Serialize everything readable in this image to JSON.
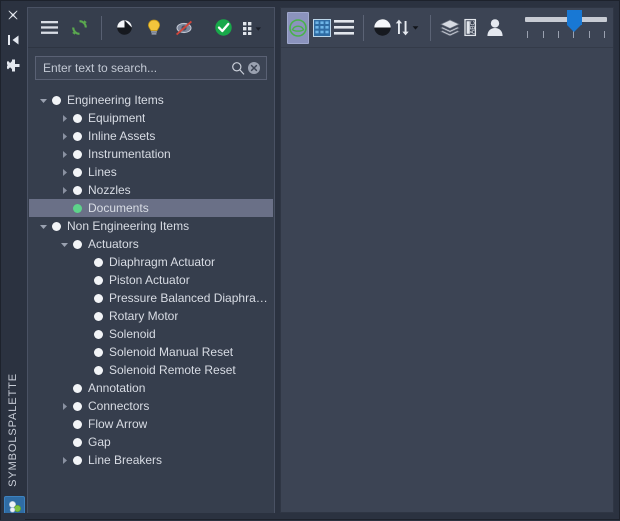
{
  "window": {
    "rail_title": "SYMBOLSPALETTE"
  },
  "rail": {
    "icons": [
      {
        "name": "close-icon",
        "label": "Close"
      },
      {
        "name": "auto-hide-icon",
        "label": "Auto Hide"
      },
      {
        "name": "settings-icon",
        "label": "Settings"
      }
    ],
    "bottom_tab": {
      "name": "symbol-palette-tab-icon",
      "label": "Symbol Palette"
    }
  },
  "panel": {
    "toolbar": [
      {
        "name": "menu-icon",
        "label": "Menu"
      },
      {
        "name": "refresh-icon",
        "label": "Refresh",
        "color": "#5aa84f"
      },
      {
        "name": "separator",
        "label": ""
      },
      {
        "name": "contrast-icon",
        "label": "Contrast"
      },
      {
        "name": "lightbulb-icon",
        "label": "Highlight",
        "color": "#f3c53c"
      },
      {
        "name": "no-preview-icon",
        "label": "Disable Preview",
        "color": "#d24b3e"
      },
      {
        "name": "validate-icon",
        "label": "Validate",
        "color": "#22a84a"
      },
      {
        "name": "grid-options-icon",
        "label": "Grid Options"
      }
    ],
    "search": {
      "placeholder": "Enter text to search...",
      "value": "",
      "search_icon": "search-icon",
      "clear_icon": "clear-icon"
    },
    "tree": [
      {
        "label": "Engineering Items",
        "indent": 0,
        "expander": "down",
        "bullet": "white",
        "selected": false
      },
      {
        "label": "Equipment",
        "indent": 1,
        "expander": "right",
        "bullet": "white",
        "selected": false
      },
      {
        "label": "Inline Assets",
        "indent": 1,
        "expander": "right",
        "bullet": "white",
        "selected": false
      },
      {
        "label": "Instrumentation",
        "indent": 1,
        "expander": "right",
        "bullet": "white",
        "selected": false
      },
      {
        "label": "Lines",
        "indent": 1,
        "expander": "right",
        "bullet": "white",
        "selected": false
      },
      {
        "label": "Nozzles",
        "indent": 1,
        "expander": "right",
        "bullet": "white",
        "selected": false
      },
      {
        "label": "Documents",
        "indent": 1,
        "expander": "none",
        "bullet": "green",
        "selected": true
      },
      {
        "label": "Non Engineering Items",
        "indent": 0,
        "expander": "down",
        "bullet": "white",
        "selected": false
      },
      {
        "label": "Actuators",
        "indent": 1,
        "expander": "down",
        "bullet": "white",
        "selected": false
      },
      {
        "label": "Diaphragm Actuator",
        "indent": 2,
        "expander": "none",
        "bullet": "white",
        "selected": false
      },
      {
        "label": "Piston Actuator",
        "indent": 2,
        "expander": "none",
        "bullet": "white",
        "selected": false
      },
      {
        "label": "Pressure Balanced Diaphrag…",
        "indent": 2,
        "expander": "none",
        "bullet": "white",
        "selected": false
      },
      {
        "label": "Rotary Motor",
        "indent": 2,
        "expander": "none",
        "bullet": "white",
        "selected": false
      },
      {
        "label": "Solenoid",
        "indent": 2,
        "expander": "none",
        "bullet": "white",
        "selected": false
      },
      {
        "label": "Solenoid Manual Reset",
        "indent": 2,
        "expander": "none",
        "bullet": "white",
        "selected": false
      },
      {
        "label": "Solenoid Remote Reset",
        "indent": 2,
        "expander": "none",
        "bullet": "white",
        "selected": false
      },
      {
        "label": "Annotation",
        "indent": 1,
        "expander": "none",
        "bullet": "white",
        "selected": false
      },
      {
        "label": "Connectors",
        "indent": 1,
        "expander": "right",
        "bullet": "white",
        "selected": false
      },
      {
        "label": "Flow Arrow",
        "indent": 1,
        "expander": "none",
        "bullet": "white",
        "selected": false
      },
      {
        "label": "Gap",
        "indent": 1,
        "expander": "none",
        "bullet": "white",
        "selected": false
      },
      {
        "label": "Line Breakers",
        "indent": 1,
        "expander": "right",
        "bullet": "white",
        "selected": false
      }
    ]
  },
  "main": {
    "toolbar": [
      {
        "name": "shape-tool-icon",
        "label": "Shape",
        "active": true,
        "color": "#4caf50"
      },
      {
        "name": "table-grid-icon",
        "label": "Table",
        "active": false,
        "color": "#3d9ad6"
      },
      {
        "name": "list-view-icon",
        "label": "List",
        "active": false
      },
      {
        "name": "separator",
        "label": ""
      },
      {
        "name": "contrast-icon",
        "label": "Contrast",
        "active": false
      },
      {
        "name": "sort-icon",
        "label": "Sort",
        "active": false
      },
      {
        "name": "separator",
        "label": ""
      },
      {
        "name": "layers-icon",
        "label": "Layers",
        "active": false
      },
      {
        "name": "abc-label-icon",
        "label": "Labels",
        "active": false
      },
      {
        "name": "user-icon",
        "label": "User",
        "active": false
      }
    ],
    "zoom_slider": {
      "name": "zoom-slider",
      "value": 60,
      "min": 0,
      "max": 100,
      "tick_count": 6
    },
    "accent": "#1878d4"
  }
}
